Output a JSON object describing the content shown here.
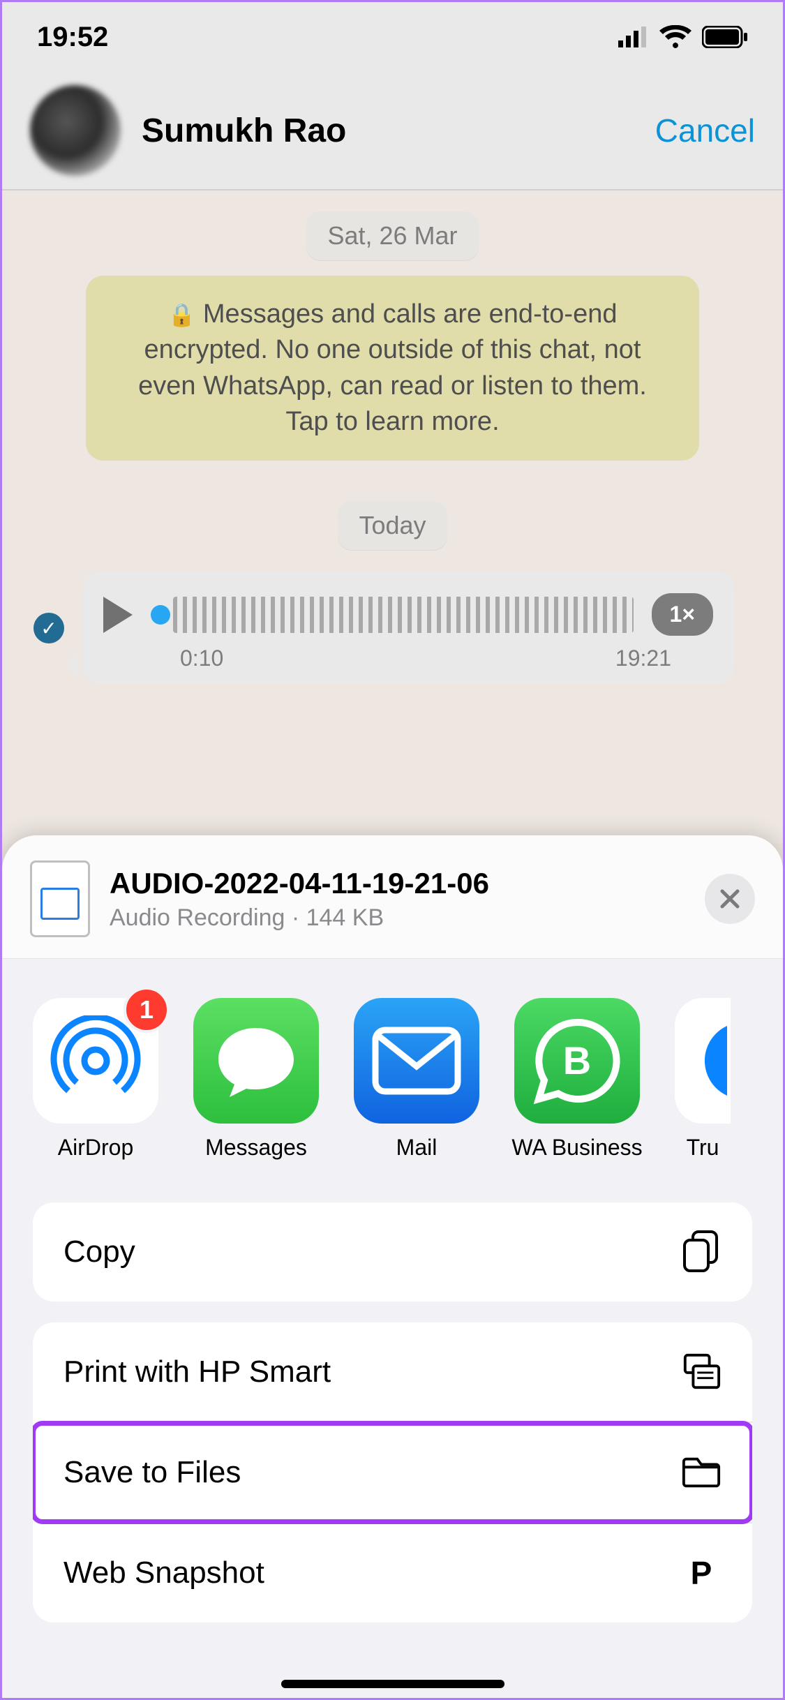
{
  "status": {
    "time": "19:52"
  },
  "header": {
    "contact_name": "Sumukh Rao",
    "cancel": "Cancel"
  },
  "chat": {
    "date1": "Sat, 26 Mar",
    "encryption_notice": "Messages and calls are end-to-end encrypted. No one outside of this chat, not even WhatsApp, can read or listen to them. Tap to learn more.",
    "date2": "Today",
    "voice": {
      "elapsed": "0:10",
      "sent_time": "19:21",
      "speed": "1×"
    }
  },
  "share": {
    "file_title": "AUDIO-2022-04-11-19-21-06",
    "file_sub": "Audio Recording · 144 KB",
    "apps": {
      "airdrop": {
        "label": "AirDrop",
        "badge": "1"
      },
      "messages": {
        "label": "Messages"
      },
      "mail": {
        "label": "Mail"
      },
      "wab": {
        "label": "WA Business"
      },
      "truecaller": {
        "label": "Tru"
      }
    },
    "actions": {
      "copy": "Copy",
      "print": "Print with HP Smart",
      "save": "Save to Files",
      "web": "Web Snapshot"
    }
  }
}
